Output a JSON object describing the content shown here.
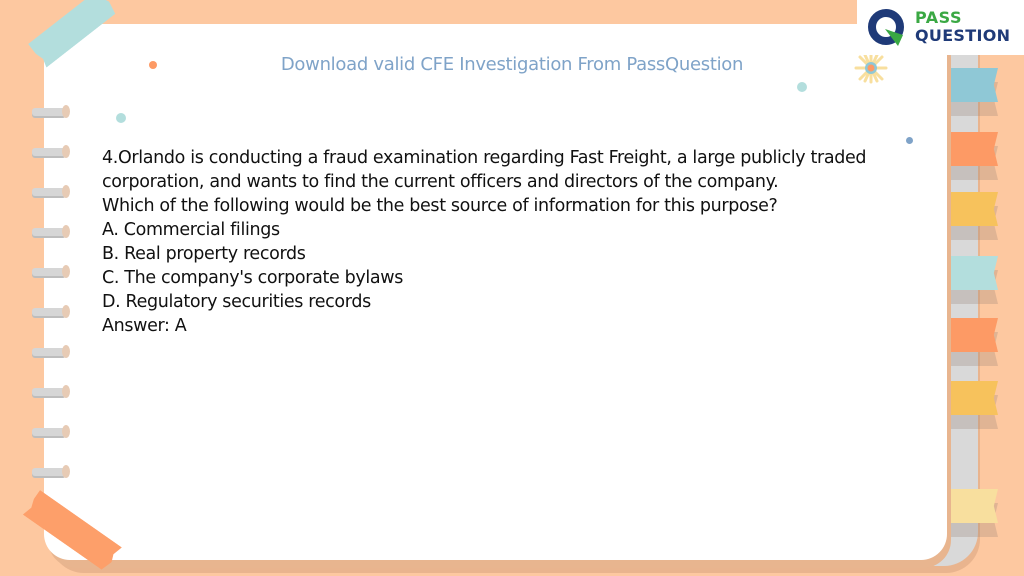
{
  "header": {
    "title": "Download valid CFE Investigation From PassQuestion"
  },
  "logo": {
    "line1": "PASS",
    "line2": "QUESTION",
    "icon": "q-logo-icon",
    "colors": {
      "green": "#3aa843",
      "navy": "#1f3a78"
    }
  },
  "question": {
    "stem_lines": [
      "4.Orlando is conducting a fraud examination regarding Fast Freight, a large publicly traded",
      "corporation, and wants to find the current officers and directors of the company.",
      "Which of the following would be the best source of information for this purpose?"
    ],
    "options": [
      "A. Commercial filings",
      "B. Real property records",
      "C. The company's corporate bylaws",
      "D. Regulatory securities records"
    ],
    "answer": "Answer: A"
  },
  "decor": {
    "background_color": "#fdc8a0",
    "tab_colors": [
      "#8fc8d6",
      "#fd9a65",
      "#f7c25c",
      "#b3dedd",
      "#fd9a65",
      "#f7c25c",
      "#f8df9e"
    ]
  }
}
